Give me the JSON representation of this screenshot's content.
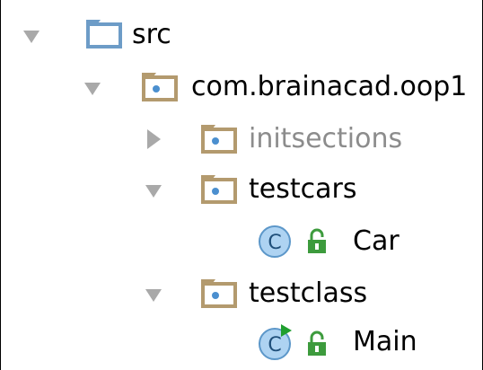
{
  "project_tree": {
    "nodes": [
      {
        "label": "src",
        "state": "expanded",
        "kind": "source-root"
      },
      {
        "label": "com.brainacad.oop1",
        "state": "expanded",
        "kind": "package"
      },
      {
        "label": "initsections",
        "state": "collapsed",
        "kind": "package"
      },
      {
        "label": "testcars",
        "state": "expanded",
        "kind": "package"
      },
      {
        "label": "Car",
        "kind": "class",
        "access": "public"
      },
      {
        "label": "testclass",
        "state": "expanded",
        "kind": "package"
      },
      {
        "label": "Main",
        "kind": "runnable-class",
        "access": "public"
      }
    ],
    "class_glyph": "C"
  },
  "colors": {
    "arrow": "#a9a9a9",
    "source_root_folder": "#6d9cc7",
    "package_folder": "#b39a6e",
    "package_dot": "#4b8fcf",
    "class_circle": "#aed3f2",
    "class_circle_border": "#5c97c9",
    "lock_green": "#3d9b3d",
    "run_arrow": "#1f9f2f",
    "dim_label": "#8c8c8c"
  }
}
